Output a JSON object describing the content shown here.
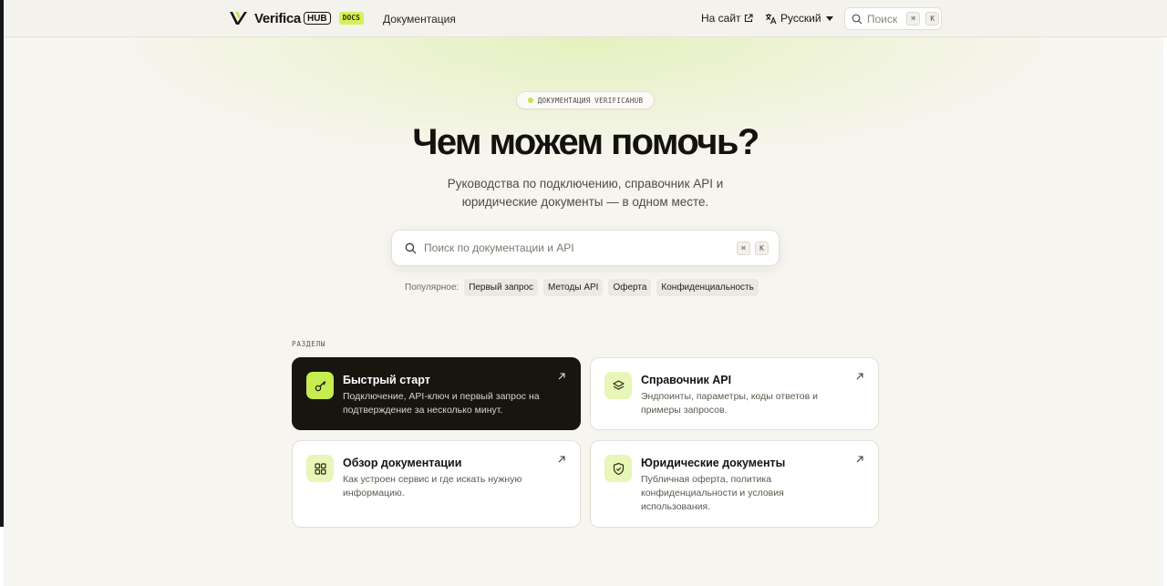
{
  "header": {
    "logo_text": "Verifica",
    "logo_hub": "HUB",
    "logo_badge": "DOCS",
    "nav_docs": "Документация",
    "nav_site": "На сайт",
    "lang": "Русский",
    "search_label": "Поиск",
    "search_kbd_mod": "⌘",
    "search_kbd_key": "K"
  },
  "hero": {
    "pill": "ДОКУМЕНТАЦИЯ VERIFICAHUB",
    "title": "Чем можем помочь?",
    "subtitle_line1": "Руководства по подключению, справочник API и",
    "subtitle_line2": "юридические документы — в одном месте.",
    "search_placeholder": "Поиск по документации и API",
    "kbd_mod": "⌘",
    "kbd_key": "K"
  },
  "popular": {
    "label": "Популярное:",
    "items": [
      "Первый запрос",
      "Методы API",
      "Оферта",
      "Конфиденциальность"
    ]
  },
  "sections": {
    "label": "РАЗДЕЛЫ",
    "cards": [
      {
        "title": "Быстрый старт",
        "desc": "Подключение, API-ключ и первый запрос на подтверждение за несколько минут.",
        "icon": "key-icon"
      },
      {
        "title": "Справочник API",
        "desc": "Эндпоинты, параметры, коды ответов и примеры запросов.",
        "icon": "layers-icon"
      },
      {
        "title": "Обзор документации",
        "desc": "Как устроен сервис и где искать нужную информацию.",
        "icon": "grid-icon"
      },
      {
        "title": "Юридические документы",
        "desc": "Публичная оферта, политика конфиденциальности и условия использования.",
        "icon": "shield-check-icon"
      }
    ]
  },
  "colors": {
    "accent": "#c6ec4f",
    "dark_card": "#18150f",
    "background": "#f7f5ef"
  }
}
